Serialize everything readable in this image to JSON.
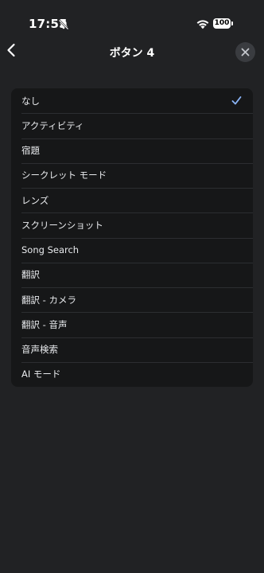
{
  "status_bar": {
    "time": "17:55",
    "battery": "100",
    "icons": [
      "bell-slash-icon",
      "wifi-icon",
      "battery-icon"
    ]
  },
  "header": {
    "title": "ボタン 4",
    "back_icon": "chevron-left-icon",
    "close_icon": "close-icon"
  },
  "list": {
    "items": [
      {
        "label": "なし",
        "selected": true
      },
      {
        "label": "アクティビティ",
        "selected": false
      },
      {
        "label": "宿題",
        "selected": false
      },
      {
        "label": "シークレット モード",
        "selected": false
      },
      {
        "label": "レンズ",
        "selected": false
      },
      {
        "label": "スクリーンショット",
        "selected": false
      },
      {
        "label": "Song Search",
        "selected": false
      },
      {
        "label": "翻訳",
        "selected": false
      },
      {
        "label": "翻訳 - カメラ",
        "selected": false
      },
      {
        "label": "翻訳 - 音声",
        "selected": false
      },
      {
        "label": "音声検索",
        "selected": false
      },
      {
        "label": "AI モード",
        "selected": false
      }
    ],
    "check_icon": "checkmark-icon"
  },
  "colors": {
    "background": "#212224",
    "list_background": "#161718",
    "accent": "#8ab4f8",
    "text": "#e8eaed"
  }
}
